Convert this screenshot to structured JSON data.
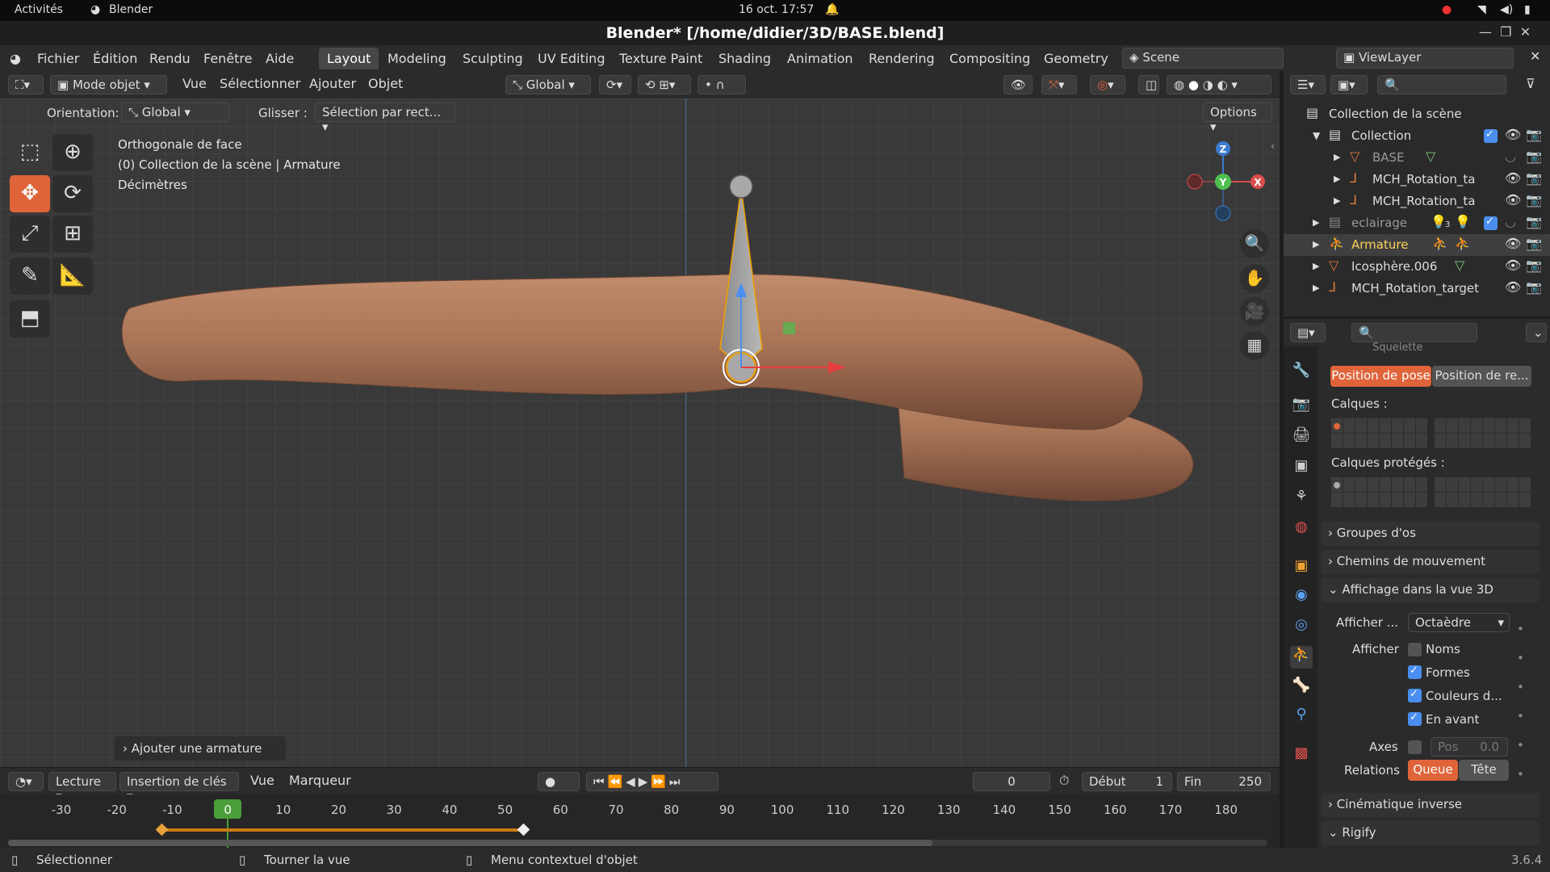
{
  "gnome": {
    "activities": "Activités",
    "app": "Blender",
    "clock": "16 oct.  17:57"
  },
  "window": {
    "title": "Blender* [/home/didier/3D/BASE.blend]"
  },
  "menus": [
    "Fichier",
    "Édition",
    "Rendu",
    "Fenêtre",
    "Aide"
  ],
  "workspaces": [
    "Layout",
    "Modeling",
    "Sculpting",
    "UV Editing",
    "Texture Paint",
    "Shading",
    "Animation",
    "Rendering",
    "Compositing",
    "Geometry N"
  ],
  "scene": {
    "label": "Scene",
    "viewlayer": "ViewLayer"
  },
  "viewport_header": {
    "mode": "Mode objet",
    "menus": [
      "Vue",
      "Sélectionner",
      "Ajouter",
      "Objet"
    ],
    "transform": "Global"
  },
  "tool_header": {
    "orientation_label": "Orientation:",
    "orientation_value": "Global",
    "drag_label": "Glisser :",
    "drag_value": "Sélection par rect...",
    "options": "Options"
  },
  "viewport": {
    "line1": "Orthogonale de face",
    "line2": "(0) Collection de la scène | Armature",
    "line3": "Décimètres",
    "last_op": "Ajouter une armature",
    "axes": {
      "z": "Z",
      "y": "Y",
      "x": "X"
    }
  },
  "outliner": {
    "root": "Collection de la scène",
    "rows": [
      {
        "label": "Collection",
        "indent": 1
      },
      {
        "label": "BASE",
        "indent": 2
      },
      {
        "label": "MCH_Rotation_ta",
        "indent": 2
      },
      {
        "label": "MCH_Rotation_ta",
        "indent": 2
      },
      {
        "label": "eclairage",
        "indent": 1
      },
      {
        "label": "Armature",
        "indent": 1
      },
      {
        "label": "Icosphère.006",
        "indent": 1
      },
      {
        "label": "MCH_Rotation_target",
        "indent": 1
      }
    ],
    "lamp_count": "3"
  },
  "properties": {
    "section_cut": "Squelette",
    "pose_btn": "Position de pose",
    "rest_btn": "Position de re...",
    "layers": "Calques :",
    "protected": "Calques protégés :",
    "panels": {
      "bone_groups": "Groupes d'os",
      "motion_paths": "Chemins de mouvement",
      "viewport_display": "Affichage dans la vue 3D",
      "ik": "Cinématique inverse",
      "rigify": "Rigify"
    },
    "display_as_label": "Afficher ...",
    "display_as_value": "Octaèdre",
    "show_label": "Afficher",
    "checks": [
      {
        "label": "Noms",
        "checked": false
      },
      {
        "label": "Formes",
        "checked": true
      },
      {
        "label": "Couleurs d...",
        "checked": true
      },
      {
        "label": "En avant",
        "checked": true
      }
    ],
    "axes_label": "Axes",
    "pos_label": "Pos",
    "pos_value": "0.0",
    "relations_label": "Relations",
    "tail": "Queue",
    "head": "Tête"
  },
  "timeline": {
    "menus": [
      "Lecture",
      "Insertion de clés",
      "Vue",
      "Marqueur"
    ],
    "current": "0",
    "start_label": "Début",
    "start": "1",
    "end_label": "Fin",
    "end": "250",
    "ticks": [
      "-30",
      "-20",
      "-10",
      "0",
      "10",
      "20",
      "30",
      "40",
      "50",
      "60",
      "70",
      "80",
      "90",
      "100",
      "110",
      "120",
      "130",
      "140",
      "150",
      "160",
      "170",
      "180"
    ]
  },
  "status": {
    "select": "Sélectionner",
    "rotate": "Tourner la vue",
    "context": "Menu contextuel d'objet",
    "version": "3.6.4"
  }
}
